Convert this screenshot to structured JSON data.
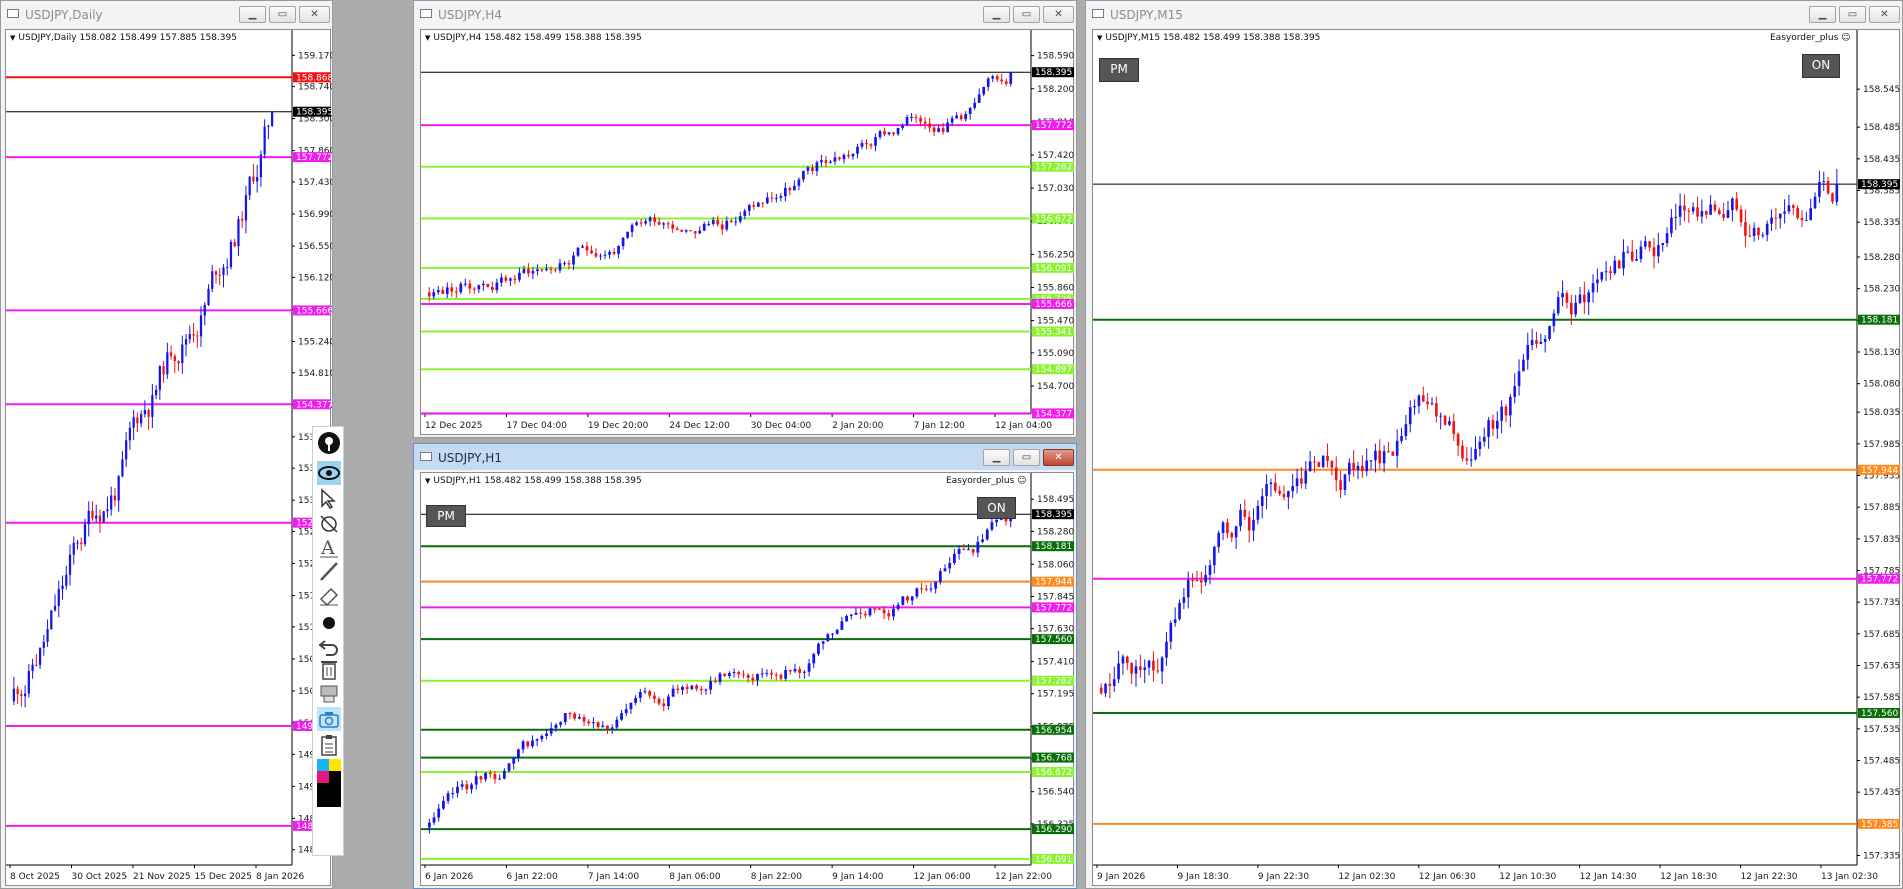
{
  "colors": {
    "bull": "#1515ea",
    "bear": "#f01313",
    "magenta": "#f21cf2",
    "light_green": "#8cf234",
    "dark_green": "#0a6e0a",
    "orange": "#ff8a1f",
    "red": "#f21010",
    "black": "#000000"
  },
  "windows": {
    "daily": {
      "title": "USDJPY,Daily",
      "header": "USDJPY,Daily  158.082 158.499 157.885 158.395"
    },
    "h4": {
      "title": "USDJPY,H4",
      "header": "USDJPY,H4  158.482 158.499 158.388 158.395"
    },
    "h1": {
      "title": "USDJPY,H1",
      "header": "USDJPY,H1  158.482 158.499 158.388 158.395",
      "ea": "Easyorder_plus ☺",
      "pm": "PM",
      "on": "ON"
    },
    "m15": {
      "title": "USDJPY,M15",
      "header": "USDJPY,M15  158.482 158.499 158.388 158.395",
      "ea": "Easyorder_plus ☺",
      "pm": "PM",
      "on": "ON"
    }
  },
  "charts": {
    "daily": {
      "ymin": 148.05,
      "ymax": 159.27,
      "yticks": [
        "159.170",
        "158.740",
        "158.300",
        "157.860",
        "157.430",
        "156.990",
        "156.550",
        "156.120",
        "155.680",
        "155.240",
        "154.810",
        "154.370",
        "153.930",
        "153.500",
        "153.060",
        "152.630",
        "152.190",
        "151.750",
        "151.320",
        "150.880",
        "150.440",
        "150.000",
        "149.570",
        "149.130",
        "148.690",
        "148.260"
      ],
      "xticks": [
        "8 Oct 2025",
        "30 Oct 2025",
        "21 Nov 2025",
        "15 Dec 2025",
        "8 Jan 2026"
      ],
      "start": 150.3,
      "end": 158.395,
      "levels": [
        {
          "v": 158.868,
          "label": "158.868",
          "c": "red"
        },
        {
          "v": 158.395,
          "label": "158.395",
          "c": "black"
        },
        {
          "v": 157.772,
          "label": "157.772",
          "c": "magenta"
        },
        {
          "v": 155.666,
          "label": "155.666",
          "c": "magenta"
        },
        {
          "v": 154.377,
          "label": "154.377",
          "c": "magenta"
        },
        {
          "v": 152.751,
          "label": "152.751",
          "c": "magenta"
        },
        {
          "v": 149.959,
          "label": "149.959",
          "c": "magenta"
        },
        {
          "v": 148.587,
          "label": "148.587",
          "c": "magenta"
        }
      ]
    },
    "h4": {
      "ymin": 154.37,
      "ymax": 158.68,
      "yticks": [
        "158.590",
        "158.200",
        "157.810",
        "157.420",
        "157.030",
        "156.640",
        "156.250",
        "155.860",
        "155.470",
        "155.090",
        "154.700",
        "154.310"
      ],
      "xticks": [
        "12 Dec 2025",
        "17 Dec 04:00",
        "19 Dec 20:00",
        "24 Dec 12:00",
        "30 Dec 04:00",
        "2 Jan 20:00",
        "7 Jan 12:00",
        "12 Jan 04:00"
      ],
      "start": 155.8,
      "end": 158.395,
      "levels": [
        {
          "v": 158.395,
          "label": "158.395",
          "c": "black"
        },
        {
          "v": 157.772,
          "label": "157.772",
          "c": "magenta"
        },
        {
          "v": 157.282,
          "label": "157.282",
          "c": "light_green"
        },
        {
          "v": 156.672,
          "label": "156.672",
          "c": "light_green"
        },
        {
          "v": 156.091,
          "label": "156.091",
          "c": "light_green"
        },
        {
          "v": 155.725,
          "label": "155.725",
          "c": "light_green"
        },
        {
          "v": 155.666,
          "label": "155.666",
          "c": "magenta"
        },
        {
          "v": 155.341,
          "label": "155.341",
          "c": "light_green"
        },
        {
          "v": 154.897,
          "label": "154.897",
          "c": "light_green"
        },
        {
          "v": 154.377,
          "label": "154.377",
          "c": "magenta"
        }
      ]
    },
    "h1": {
      "ymin": 156.05,
      "ymax": 158.55,
      "yticks": [
        "158.495",
        "158.280",
        "158.060",
        "157.845",
        "157.630",
        "157.410",
        "157.195",
        "156.975",
        "156.760",
        "156.540",
        "156.325"
      ],
      "xticks": [
        "6 Jan 2026",
        "6 Jan 22:00",
        "7 Jan 14:00",
        "8 Jan 06:00",
        "8 Jan 22:00",
        "9 Jan 14:00",
        "12 Jan 06:00",
        "12 Jan 22:00"
      ],
      "start": 156.3,
      "end": 158.395,
      "levels": [
        {
          "v": 158.395,
          "label": "158.395",
          "c": "black"
        },
        {
          "v": 158.181,
          "label": "158.181",
          "c": "dark_green"
        },
        {
          "v": 157.944,
          "label": "157.944",
          "c": "orange"
        },
        {
          "v": 157.772,
          "label": "157.772",
          "c": "magenta"
        },
        {
          "v": 157.56,
          "label": "157.560",
          "c": "dark_green"
        },
        {
          "v": 157.282,
          "label": "157.282",
          "c": "light_green"
        },
        {
          "v": 156.954,
          "label": "156.954",
          "c": "dark_green"
        },
        {
          "v": 156.768,
          "label": "156.768",
          "c": "dark_green"
        },
        {
          "v": 156.672,
          "label": "156.672",
          "c": "light_green"
        },
        {
          "v": 156.29,
          "label": "156.290",
          "c": "dark_green"
        },
        {
          "v": 156.091,
          "label": "156.091",
          "c": "light_green"
        }
      ]
    },
    "m15": {
      "ymin": 157.32,
      "ymax": 158.61,
      "yticks": [
        "158.545",
        "158.485",
        "158.435",
        "158.385",
        "158.335",
        "158.280",
        "158.230",
        "158.180",
        "158.130",
        "158.080",
        "158.035",
        "157.985",
        "157.935",
        "157.885",
        "157.835",
        "157.785",
        "157.735",
        "157.685",
        "157.635",
        "157.585",
        "157.535",
        "157.485",
        "157.435",
        "157.385",
        "157.335"
      ],
      "xticks": [
        "9 Jan 2026",
        "9 Jan 18:30",
        "9 Jan 22:30",
        "12 Jan 02:30",
        "12 Jan 06:30",
        "12 Jan 10:30",
        "12 Jan 14:30",
        "12 Jan 18:30",
        "12 Jan 22:30",
        "13 Jan 02:30"
      ],
      "start": 157.6,
      "end": 158.395,
      "levels": [
        {
          "v": 158.395,
          "label": "158.395",
          "c": "black"
        },
        {
          "v": 158.181,
          "label": "158.181",
          "c": "dark_green"
        },
        {
          "v": 157.944,
          "label": "157.944",
          "c": "orange"
        },
        {
          "v": 157.772,
          "label": "157.772",
          "c": "magenta"
        },
        {
          "v": 157.56,
          "label": "157.560",
          "c": "dark_green"
        },
        {
          "v": 157.385,
          "label": "157.385",
          "c": "orange"
        }
      ]
    }
  },
  "toolbar": [
    "pin-icon",
    "eye-icon",
    "cursor-icon",
    "crosshair-icon",
    "text-icon",
    "trendline-icon",
    "eraser-icon",
    "dot-icon",
    "undo-icon",
    "trash-icon",
    "template-icon",
    "camera-icon",
    "clipboard-icon",
    "color-palette-icon"
  ]
}
